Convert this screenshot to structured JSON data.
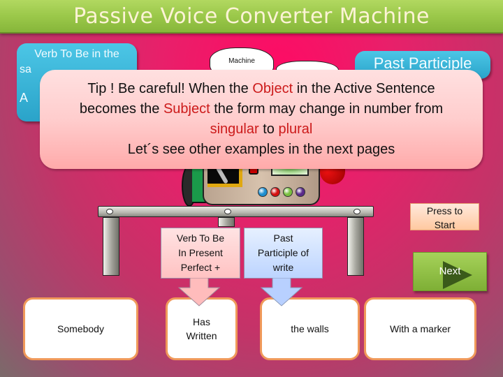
{
  "header": {
    "title": "Passive Voice Converter Machine"
  },
  "background_color": "#ff0a64",
  "labels": {
    "verb_to_be_box": {
      "line1": "Verb To Be in the",
      "line2_partial": "sa",
      "line3_partial": "A"
    },
    "past_participle_box": "Past Participle"
  },
  "machine": {
    "cloud_label": "Machine",
    "indicator_colors": [
      "#1e8fd0",
      "#d41010",
      "#7ac040",
      "#5a2a8a"
    ]
  },
  "tip": {
    "line1_pre": "Tip !  Be careful! When the ",
    "line1_hl": "Object",
    "line1_post": " in the Active Sentence",
    "line2_pre": "becomes the ",
    "line2_hl": "Subject",
    "line2_post": " the form may change in number from",
    "line3_hl1": "singular",
    "line3_mid": " to ",
    "line3_hl2": "plural",
    "line4": "Let´s see other examples in the next pages",
    "highlight_color": "#cc1a1a"
  },
  "callouts": {
    "verb_to_be": [
      "Verb To Be",
      "In Present",
      "Perfect +"
    ],
    "past_participle": [
      "Past",
      "Participle of",
      "write"
    ]
  },
  "buttons": {
    "start": [
      "Press  to",
      "Start"
    ],
    "next": "Next"
  },
  "word_cards": [
    {
      "lines": [
        "Somebody"
      ]
    },
    {
      "lines": [
        "Has",
        "Written"
      ]
    },
    {
      "lines": [
        "the  walls"
      ]
    },
    {
      "lines": [
        "With a marker"
      ]
    }
  ]
}
